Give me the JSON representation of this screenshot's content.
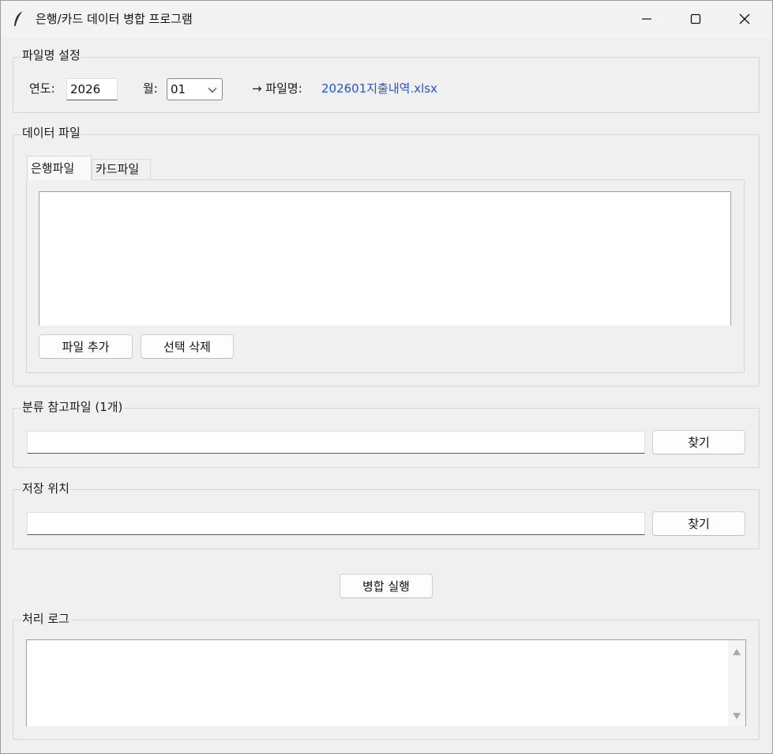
{
  "window": {
    "title": "은행/카드 데이터 병합 프로그램",
    "icon": "feather-icon"
  },
  "filename_section": {
    "label": "파일명 설정",
    "year_label": "연도:",
    "year_value": "2026",
    "month_label": "월:",
    "month_value": "01",
    "arrow_label": "→ 파일명:",
    "filename": "202601지출내역.xlsx",
    "filename_color": "#2255dd"
  },
  "data_section": {
    "label": "데이터 파일",
    "tabs": [
      {
        "label": "은행파일",
        "active": true
      },
      {
        "label": "카드파일",
        "active": false
      }
    ],
    "add_button": "파일 추가",
    "delete_button": "선택 삭제"
  },
  "reference_section": {
    "label": "분류 참고파일 (1개)",
    "path_value": "",
    "browse_button": "찾기"
  },
  "save_section": {
    "label": "저장 위치",
    "path_value": "",
    "browse_button": "찾기"
  },
  "merge_button": "병합 실행",
  "log_section": {
    "label": "처리 로그"
  }
}
